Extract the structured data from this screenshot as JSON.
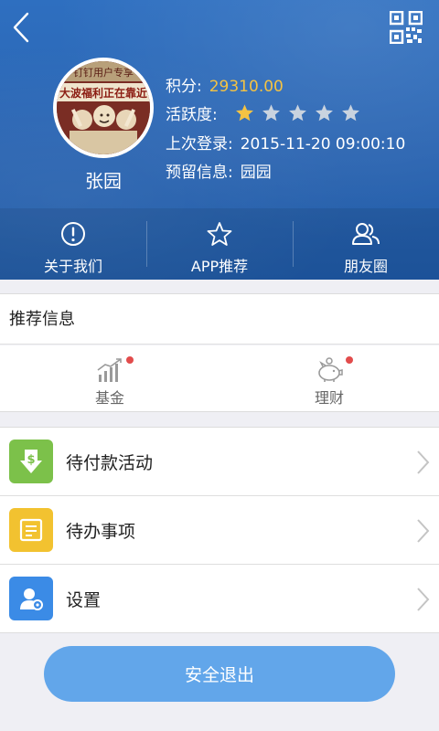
{
  "profile": {
    "name": "张园",
    "score_label": "积分:",
    "score_value": "29310.00",
    "activity_label": "活跃度:",
    "activity_stars": 1,
    "activity_stars_total": 5,
    "last_login_label": "上次登录:",
    "last_login_value": "2015-11-20 09:00:10",
    "reserved_label": "预留信息:",
    "reserved_value": "园园",
    "avatar_banner_text": "大波福利正在靠近",
    "avatar_top_text": "钉钉用户专享"
  },
  "actions": [
    {
      "label": "关于我们",
      "icon": "info-circle-icon"
    },
    {
      "label": "APP推荐",
      "icon": "star-outline-icon"
    },
    {
      "label": "朋友圈",
      "icon": "people-icon"
    }
  ],
  "recommend": {
    "title": "推荐信息",
    "items": [
      {
        "label": "基金",
        "icon": "chart-bars-icon",
        "badge": true
      },
      {
        "label": "理财",
        "icon": "piggy-bank-icon",
        "badge": true
      }
    ]
  },
  "menu": [
    {
      "label": "待付款活动",
      "icon": "payment-download-icon",
      "color": "#7cc14a"
    },
    {
      "label": "待办事项",
      "icon": "todo-list-icon",
      "color": "#f2c230"
    },
    {
      "label": "设置",
      "icon": "user-settings-icon",
      "color": "#3b8be6"
    }
  ],
  "logout_label": "安全退出",
  "colors": {
    "header": "#2a64b1",
    "score": "#f5c343",
    "badge": "#e24c4c",
    "logout": "#62a6ea"
  }
}
